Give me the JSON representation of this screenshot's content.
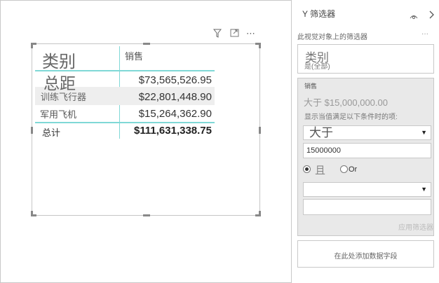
{
  "visual": {
    "header_icons": [
      "filter-icon",
      "focus-mode-icon",
      "more-options-icon"
    ],
    "more_label": "⋯",
    "table": {
      "columns": [
        "类别",
        "销售"
      ],
      "rows": [
        {
          "category": "总距",
          "sales": "$73,565,526.95"
        },
        {
          "category": "训练飞行器",
          "sales": "$22,801,448.90"
        },
        {
          "category": "军用飞机",
          "sales": "$15,264,362.90"
        }
      ],
      "total": {
        "label": "总计",
        "value": "$111,631,338.75"
      }
    }
  },
  "filters_pane": {
    "title": "Y 筛选器",
    "section_title": "此视觉对象上的筛选器",
    "section_more": "···",
    "category_card": {
      "field": "类别",
      "summary": "是(全部)"
    },
    "sales_card": {
      "field": "销售",
      "summary": "大于 $15,000,000.00",
      "instruction": "显示当值满足以下条件时的项:",
      "condition1": "大于",
      "value1": "15000000",
      "logic_and": "且",
      "logic_or": "Or",
      "selected_logic": "and",
      "condition2": "",
      "value2": "",
      "apply_label": "应用筛选器"
    },
    "add_field_label": "在此处添加数据字段"
  }
}
